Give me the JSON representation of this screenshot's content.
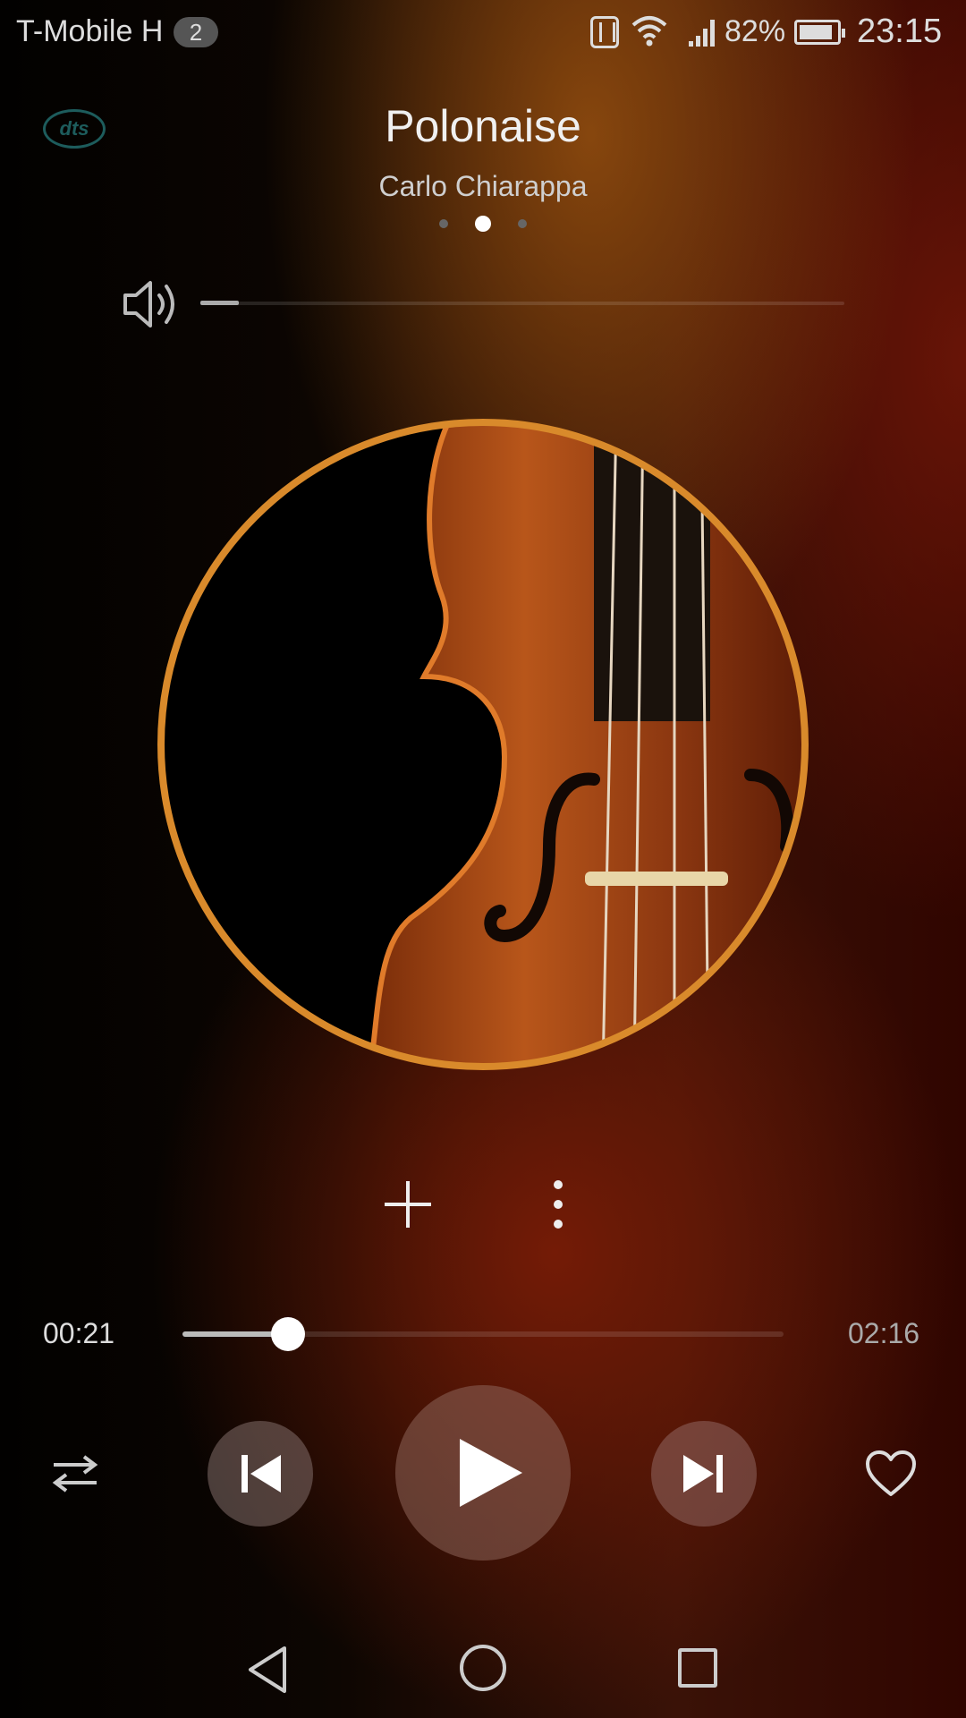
{
  "status_bar": {
    "carrier": "T-Mobile H",
    "sim_badge": "2",
    "battery_percent": "82%",
    "time": "23:15",
    "icons": [
      "nfc-icon",
      "wifi-icon",
      "signal-icon",
      "battery-icon"
    ]
  },
  "header": {
    "dts_label": "dts",
    "song_title": "Polonaise",
    "artist": "Carlo Chiarappa",
    "page_dots": {
      "count": 3,
      "active_index": 1
    }
  },
  "volume": {
    "level": 0.06,
    "icon": "speaker-icon"
  },
  "album_art": {
    "subject": "violin",
    "ring_color": "#d98a2b"
  },
  "actions": {
    "add_icon": "plus-icon",
    "more_icon": "more-vertical-icon"
  },
  "progress": {
    "current": "00:21",
    "total": "02:16",
    "fraction": 0.175
  },
  "controls": {
    "shuffle_icon": "repeat-shuffle-icon",
    "prev_icon": "skip-previous-icon",
    "play_icon": "play-icon",
    "next_icon": "skip-next-icon",
    "favorite_icon": "heart-icon"
  },
  "nav_bar": {
    "back_icon": "back-icon",
    "home_icon": "home-icon",
    "recent_icon": "recent-apps-icon"
  },
  "colors": {
    "accent": "#d98a2b",
    "background_dark": "#0d0602",
    "background_red": "#3a1207"
  }
}
